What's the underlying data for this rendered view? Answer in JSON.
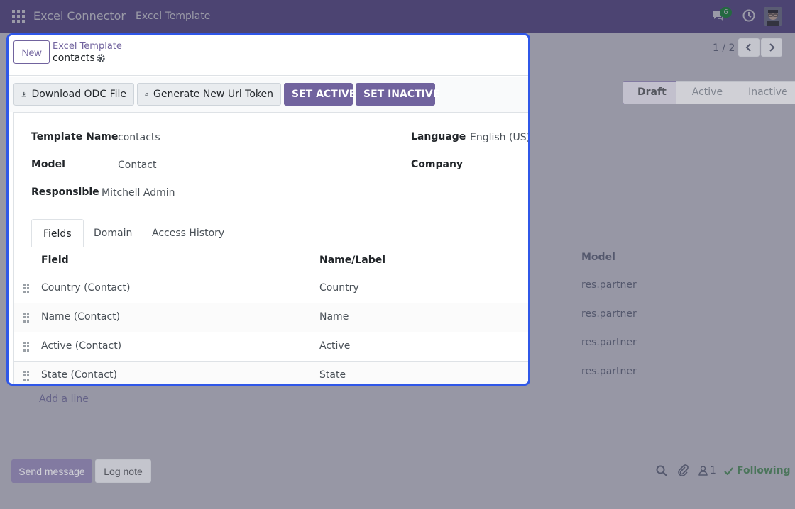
{
  "navbar": {
    "app_name": "Excel Connector",
    "menu_item": "Excel Template",
    "chat_count": "6"
  },
  "breadcrumb": {
    "parent": "Excel Template",
    "current": "contacts"
  },
  "control": {
    "new_label": "New",
    "pager": "1 / 2"
  },
  "statusbar": {
    "download_label": "Download ODC File",
    "generate_label": "Generate New Url Token",
    "set_active_label": "SET ACTIVE",
    "set_inactive_label": "SET INACTIVE",
    "stages": [
      "Draft",
      "Active",
      "Inactive"
    ],
    "current_stage": "Draft"
  },
  "form": {
    "template_name_label": "Template Name",
    "template_name_value": "contacts",
    "model_label": "Model",
    "model_value": "Contact",
    "responsible_label": "Responsible",
    "responsible_value": "Mitchell Admin",
    "language_label": "Language",
    "language_value": "English (US)",
    "company_label": "Company",
    "company_value": ""
  },
  "tabs": [
    "Fields",
    "Domain",
    "Access History"
  ],
  "table": {
    "headers": [
      "Field",
      "Name/Label",
      "Model"
    ],
    "rows": [
      {
        "field": "Country (Contact)",
        "label": "Country",
        "model": "res.partner"
      },
      {
        "field": "Name (Contact)",
        "label": "Name",
        "model": "res.partner"
      },
      {
        "field": "Active (Contact)",
        "label": "Active",
        "model": "res.partner"
      },
      {
        "field": "State (Contact)",
        "label": "State",
        "model": "res.partner"
      }
    ],
    "add_line": "Add a line"
  },
  "chatter": {
    "send_label": "Send message",
    "log_label": "Log note",
    "followers_count": "1",
    "following_label": "Following"
  },
  "colors": {
    "brand": "#71639e",
    "highlight": "#2f57e8",
    "success": "#28a745"
  }
}
